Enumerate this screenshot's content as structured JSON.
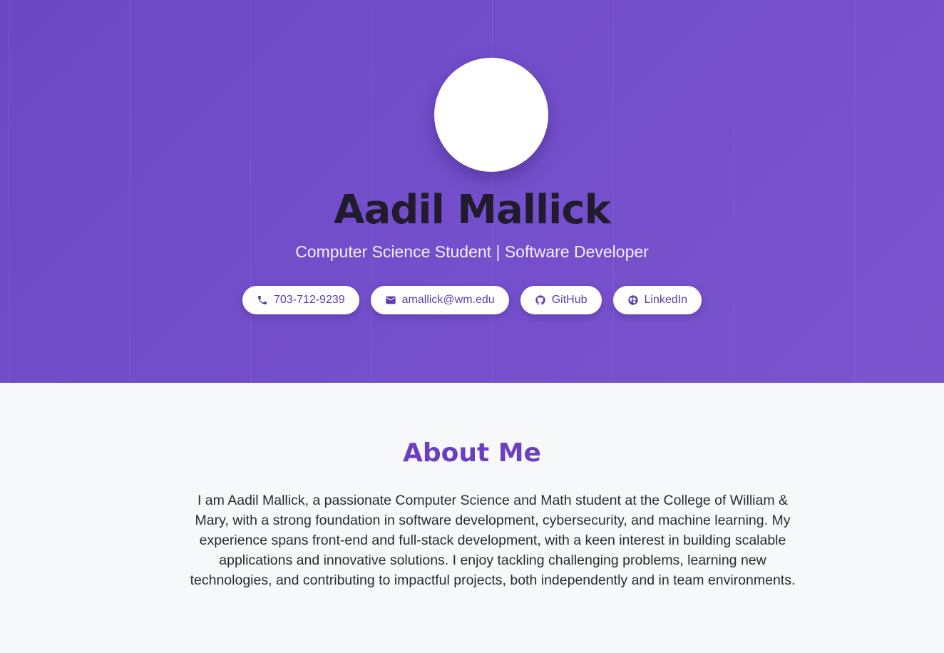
{
  "hero": {
    "name": "Aadil Mallick",
    "subtitle": "Computer Science Student | Software Developer",
    "contacts": [
      {
        "label": "703-712-9239",
        "icon": "phone-icon"
      },
      {
        "label": "amallick@wm.edu",
        "icon": "mail-icon"
      },
      {
        "label": "GitHub",
        "icon": "github-icon"
      },
      {
        "label": "LinkedIn",
        "icon": "globe-icon"
      }
    ]
  },
  "about": {
    "title": "About Me",
    "text": "I am Aadil Mallick, a passionate Computer Science and Math student at the College of William & Mary, with a strong foundation in software development, cybersecurity, and machine learning. My experience spans front-end and full-stack development, with a keen interest in building scalable applications and innovative solutions. I enjoy tackling challenging problems, learning new technologies, and contributing to impactful projects, both independently and in team environments."
  },
  "colors": {
    "hero_bg": "#744fcb",
    "accent": "#6a3fc0",
    "pill_text": "#5b3bb4",
    "about_bg": "#f7f8fa"
  }
}
